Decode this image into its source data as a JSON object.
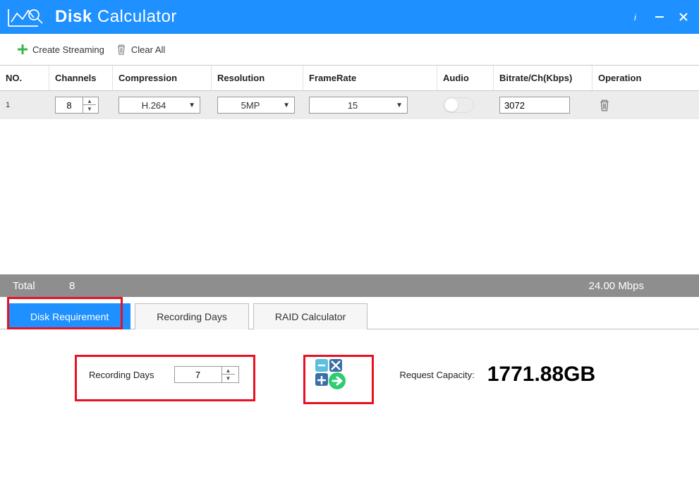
{
  "title": {
    "bold": "Disk",
    "light": "Calculator"
  },
  "toolbar": {
    "create": "Create Streaming",
    "clear": "Clear All"
  },
  "headers": {
    "no": "NO.",
    "channels": "Channels",
    "compression": "Compression",
    "resolution": "Resolution",
    "framerate": "FrameRate",
    "audio": "Audio",
    "bitrate": "Bitrate/Ch(Kbps)",
    "operation": "Operation"
  },
  "row": {
    "no": "1",
    "channels": "8",
    "compression": "H.264",
    "resolution": "5MP",
    "framerate": "15",
    "bitrate": "3072"
  },
  "total": {
    "label": "Total",
    "channels": "8",
    "bandwidth": "24.00 Mbps"
  },
  "tabs": {
    "diskreq": "Disk Requirement",
    "recdays": "Recording Days",
    "raid": "RAID Calculator"
  },
  "disk_req": {
    "label": "Recording Days",
    "days": "7",
    "result_label": "Request Capacity:",
    "result_value": "1771.88GB"
  }
}
